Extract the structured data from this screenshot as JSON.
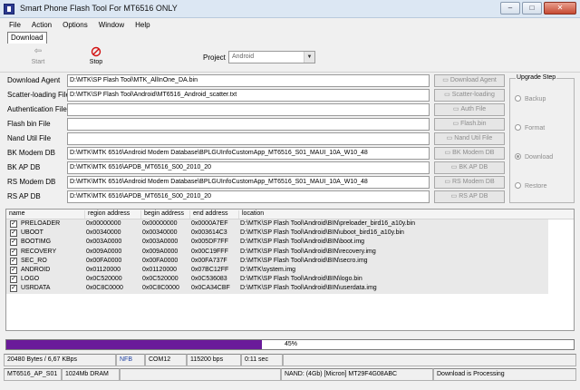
{
  "window": {
    "title": "Smart Phone Flash Tool For MT6516 ONLY",
    "minimize": "‒",
    "maximize": "□",
    "close": "✕"
  },
  "menu": [
    "File",
    "Action",
    "Options",
    "Window",
    "Help"
  ],
  "tab": {
    "label": "Download"
  },
  "toolbar": {
    "start_label": "Start",
    "start_icon": "start-arrow-icon",
    "stop_label": "Stop",
    "stop_icon": "stop-circle-icon",
    "project_label": "Project",
    "project_value": "Android"
  },
  "fields": [
    {
      "label": "Download Agent",
      "value": "D:\\MTK\\SP Flash Tool\\MTK_AllInOne_DA.bin"
    },
    {
      "label": "Scatter-loading File",
      "value": "D:\\MTK\\SP Flash Tool\\Android\\MT6516_Android_scatter.txt"
    },
    {
      "label": "Authentication File",
      "value": ""
    },
    {
      "label": "Flash bin File",
      "value": ""
    },
    {
      "label": "Nand Util File",
      "value": ""
    },
    {
      "label": "BK Modem DB",
      "value": "D:\\MTK\\MTK 6516\\Android Modem Database\\BPLGUInfoCustomApp_MT6516_S01_MAUI_10A_W10_48"
    },
    {
      "label": "BK AP DB",
      "value": "D:\\MTK\\MTK 6516\\APDB_MT6516_S00_2010_20"
    },
    {
      "label": "RS Modem DB",
      "value": "D:\\MTK\\MTK 6516\\Android Modem Database\\BPLGUInfoCustomApp_MT6516_S01_MAUI_10A_W10_48"
    },
    {
      "label": "RS AP DB",
      "value": "D:\\MTK\\MTK 6516\\APDB_MT6516_S00_2010_20"
    }
  ],
  "side_buttons": [
    "Download Agent",
    "Scatter-loading",
    "Auth File",
    "Flash.bin",
    "Nand Util File",
    "BK Modem DB",
    "BK AP DB",
    "RS Modem DB",
    "RS AP DB"
  ],
  "upgrade": {
    "legend": "Upgrade Step",
    "options": [
      "Backup",
      "Format",
      "Download",
      "Restore"
    ],
    "selected": "Download"
  },
  "list": {
    "columns": [
      "name",
      "region address",
      "begin address",
      "end address",
      "location"
    ],
    "rows": [
      {
        "checked": true,
        "name": "PRELOADER",
        "region": "0x00000000",
        "begin": "0x00000000",
        "end": "0x0000A7EF",
        "location": "D:\\MTK\\SP Flash Tool\\Android\\BIN\\preloader_bird16_a10y.bin"
      },
      {
        "checked": true,
        "name": "UBOOT",
        "region": "0x00340000",
        "begin": "0x00340000",
        "end": "0x003614C3",
        "location": "D:\\MTK\\SP Flash Tool\\Android\\BIN\\uboot_bird16_a10y.bin"
      },
      {
        "checked": true,
        "name": "BOOTIMG",
        "region": "0x003A0000",
        "begin": "0x003A0000",
        "end": "0x005DF7FF",
        "location": "D:\\MTK\\SP Flash Tool\\Android\\BIN\\boot.img"
      },
      {
        "checked": true,
        "name": "RECOVERY",
        "region": "0x009A0000",
        "begin": "0x009A0000",
        "end": "0x00C19FFF",
        "location": "D:\\MTK\\SP Flash Tool\\Android\\BIN\\recovery.img"
      },
      {
        "checked": true,
        "name": "SEC_RO",
        "region": "0x00FA0000",
        "begin": "0x00FA0000",
        "end": "0x00FA737F",
        "location": "D:\\MTK\\SP Flash Tool\\Android\\BIN\\secro.img"
      },
      {
        "checked": true,
        "name": "ANDROID",
        "region": "0x01120000",
        "begin": "0x01120000",
        "end": "0x07BC12FF",
        "location": "D:\\MTK\\system.img"
      },
      {
        "checked": true,
        "name": "LOGO",
        "region": "0x0C520000",
        "begin": "0x0C520000",
        "end": "0x0C536083",
        "location": "D:\\MTK\\SP Flash Tool\\Android\\BIN\\logo.bin"
      },
      {
        "checked": true,
        "name": "USRDATA",
        "region": "0x0C8C0000",
        "begin": "0x0C8C0000",
        "end": "0x0CA34CBF",
        "location": "D:\\MTK\\SP Flash Tool\\Android\\BIN\\userdata.img"
      }
    ]
  },
  "progress": {
    "percent_text": "45%",
    "fraction": 0.45,
    "color": "#6a1b9a"
  },
  "status1": {
    "bytes": "20480 Bytes / 6,67 KBps",
    "mode": "NFB",
    "port": "COM12",
    "baud": "115200 bps",
    "time": "0:11 sec"
  },
  "status2": {
    "chip": "MT6516_AP_S01",
    "ram": "1024Mb DRAM",
    "nand": "NAND: (4Gb) [Micron] MT29F4G08ABC",
    "state": "Download is Processing"
  }
}
